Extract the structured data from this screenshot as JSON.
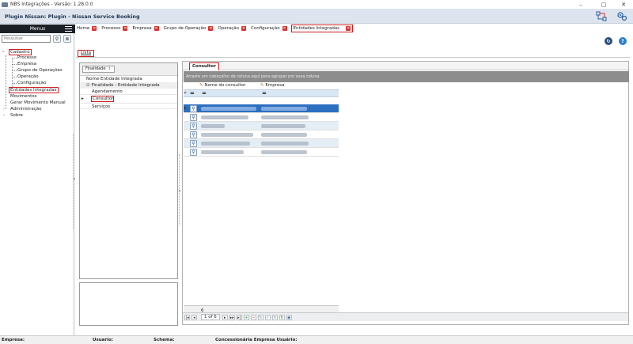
{
  "window": {
    "title": "NBS Integrações - Versão: 1.28.0.0",
    "controls": [
      "–",
      "▢",
      "✕"
    ]
  },
  "app": {
    "plugin_title": "Plugin Nissan: Plugin - Nissan Service Booking"
  },
  "menu": {
    "header": "Menus",
    "search_placeholder": "Pesquisar",
    "tree": {
      "cadastro": "Cadastro",
      "children": [
        "Processo",
        "Empresa",
        "Grupo de Operações",
        "Operação",
        "Configuração",
        "Entidades Integradas"
      ],
      "movimentos": "Movimentos",
      "gerar": "Gerar Movimento Manual",
      "administracao": "Administração",
      "sobre": "Sobre"
    }
  },
  "tabs": [
    {
      "label": "Home"
    },
    {
      "label": "Processo"
    },
    {
      "label": "Empresa"
    },
    {
      "label": "Grupo de Operação"
    },
    {
      "label": "Operação"
    },
    {
      "label": "Configuração"
    },
    {
      "label": "Entidades Integradas"
    }
  ],
  "lista_tab": "Lista",
  "finalidade": {
    "chip": "Finalidade",
    "group_header": "Nome Entidade Integrada",
    "subgroup": "Finalidade : Entidade Integrada",
    "items": [
      "Agendamento",
      "Consultor",
      "Serviços"
    ]
  },
  "consultor": {
    "tab": "Consultor",
    "group_hint": "Arraste um cabeçalho de coluna aqui para agrupar por essa coluna",
    "columns": [
      "Nome do consultor",
      "Empresa"
    ],
    "row_count": 6,
    "footer_count": "6",
    "page_info": "1 of 6"
  },
  "status": {
    "empresa": "Empresa:",
    "usuario": "Usuario:",
    "schema": "Schema:",
    "concessionaria": "Concessionária Empresa Usuário:"
  },
  "colors": {
    "accent_red": "#d9322e",
    "selected_row": "#2d6fc1",
    "menu_header": "#1b1f26"
  }
}
